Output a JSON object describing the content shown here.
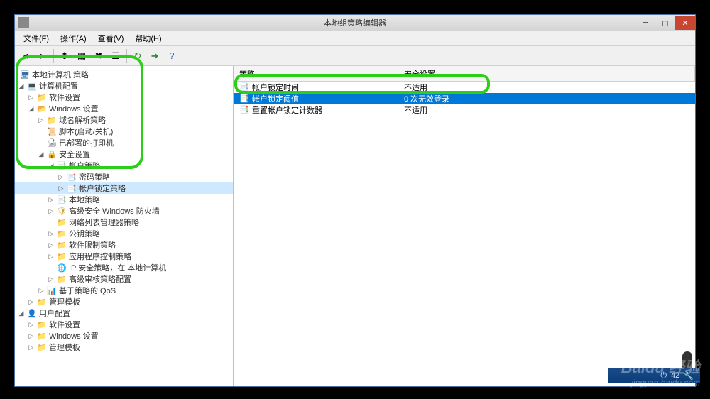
{
  "window": {
    "title": "本地组策略编辑器"
  },
  "menu": {
    "file": "文件(F)",
    "action": "操作(A)",
    "view": "查看(V)",
    "help": "帮助(H)"
  },
  "tree": {
    "root": "本地计算机 策略",
    "computer_config": "计算机配置",
    "software_settings": "软件设置",
    "windows_settings": "Windows 设置",
    "name_resolution_policy": "域名解析策略",
    "scripts": "脚本(启动/关机)",
    "deployed_printers": "已部署的打印机",
    "security_settings": "安全设置",
    "account_policies": "帐户策略",
    "password_policy": "密码策略",
    "account_lockout_policy": "帐户锁定策略",
    "local_policies": "本地策略",
    "windows_firewall": "高级安全 Windows 防火墙",
    "network_list_manager": "网络列表管理器策略",
    "public_key_policies": "公钥策略",
    "software_restriction": "软件限制策略",
    "app_control": "应用程序控制策略",
    "ip_security": "IP 安全策略，在 本地计算机",
    "advanced_audit": "高级审核策略配置",
    "policy_based_qos": "基于策略的 QoS",
    "admin_templates": "管理模板",
    "user_config": "用户配置",
    "user_software": "软件设置",
    "user_windows": "Windows 设置",
    "user_admin_templates": "管理模板"
  },
  "list": {
    "col_policy": "策略",
    "col_setting": "安全设置",
    "rows": [
      {
        "policy": "帐户锁定时间",
        "setting": "不适用"
      },
      {
        "policy": "帐户锁定阈值",
        "setting": "0 次无效登录"
      },
      {
        "policy": "重置帐户锁定计数器",
        "setting": "不适用"
      }
    ]
  },
  "watermark": {
    "line1": "Baidu 经验",
    "line2": "jingyan.baidu.com"
  },
  "taskbar": {
    "time": "42"
  }
}
